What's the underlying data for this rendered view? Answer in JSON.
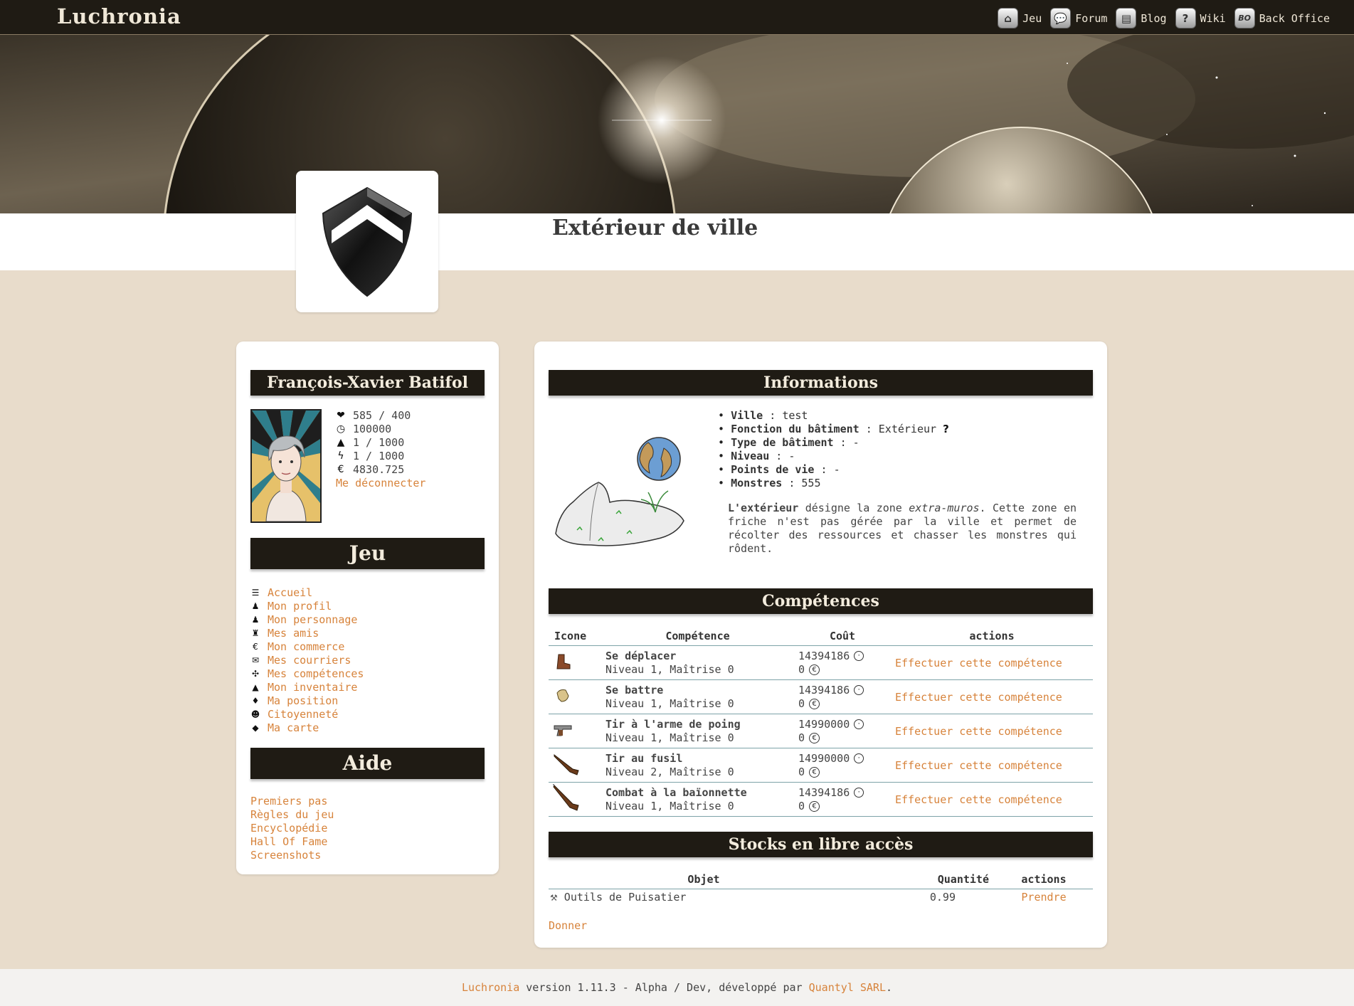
{
  "topbar": {
    "brand": "Luchronia",
    "nav": [
      {
        "label": "Jeu",
        "icon": "home-icon",
        "glyph": "⌂"
      },
      {
        "label": "Forum",
        "icon": "speech-bubble-icon",
        "glyph": "💬"
      },
      {
        "label": "Blog",
        "icon": "book-icon",
        "glyph": "▤"
      },
      {
        "label": "Wiki",
        "icon": "question-icon",
        "glyph": "?"
      },
      {
        "label": "Back Office",
        "icon": "bo-icon",
        "glyph": "BO"
      }
    ]
  },
  "page": {
    "title": "Extérieur de ville"
  },
  "sidebar": {
    "player_name": "François-Xavier Batifol",
    "stats": [
      {
        "icon": "heart-icon",
        "glyph": "❤",
        "value": "585 / 400"
      },
      {
        "icon": "clock-icon",
        "glyph": "◷",
        "value": "100000"
      },
      {
        "icon": "drop-icon",
        "glyph": "▲",
        "value": "1 / 1000"
      },
      {
        "icon": "lightning-icon",
        "glyph": "ϟ",
        "value": "1 / 1000"
      },
      {
        "icon": "euro-icon",
        "glyph": "€",
        "value": "4830.725"
      }
    ],
    "logout": "Me déconnecter",
    "game_title": "Jeu",
    "game_menu": [
      {
        "label": "Accueil",
        "icon": "list-icon",
        "glyph": "☰"
      },
      {
        "label": "Mon profil",
        "icon": "person-icon",
        "glyph": "♟"
      },
      {
        "label": "Mon personnage",
        "icon": "character-icon",
        "glyph": "♟"
      },
      {
        "label": "Mes amis",
        "icon": "friends-icon",
        "glyph": "♜"
      },
      {
        "label": "Mon commerce",
        "icon": "euro-icon",
        "glyph": "€"
      },
      {
        "label": "Mes courriers",
        "icon": "envelope-icon",
        "glyph": "✉"
      },
      {
        "label": "Mes compétences",
        "icon": "skills-icon",
        "glyph": "✣"
      },
      {
        "label": "Mon inventaire",
        "icon": "bag-icon",
        "glyph": "▲"
      },
      {
        "label": "Ma position",
        "icon": "pin-icon",
        "glyph": "♦"
      },
      {
        "label": "Citoyenneté",
        "icon": "citizen-icon",
        "glyph": "☻"
      },
      {
        "label": "Ma carte",
        "icon": "map-icon",
        "glyph": "◆"
      }
    ],
    "help_title": "Aide",
    "help_menu": [
      "Premiers pas",
      "Règles du jeu",
      "Encyclopédie",
      "Hall Of Fame",
      "Screenshots"
    ]
  },
  "informations": {
    "title": "Informations",
    "fields": [
      {
        "label": "Ville",
        "value": "test"
      },
      {
        "label": "Fonction du bâtiment",
        "value": "Extérieur"
      },
      {
        "label": "Type de bâtiment",
        "value": "-"
      },
      {
        "label": "Niveau",
        "value": "-"
      },
      {
        "label": "Points de vie",
        "value": "-"
      },
      {
        "label": "Monstres",
        "value": "555"
      }
    ],
    "help_marker": "?",
    "desc_bold": "L'extérieur",
    "desc_1": " désigne la zone ",
    "desc_italic": "extra-muros",
    "desc_2": ". Cette zone en friche n'est pas gérée par la ville et permet de récolter des ressources et chasser les monstres qui rôdent."
  },
  "competences": {
    "title": "Compétences",
    "headers": [
      "Icone",
      "Compétence",
      "Coût",
      "actions"
    ],
    "rows": [
      {
        "icon": "boot-icon",
        "name": "Se déplacer",
        "detail": "Niveau 1, Maîtrise 0",
        "time": "14394186",
        "money": "0",
        "action": "Effectuer cette compétence"
      },
      {
        "icon": "fist-icon",
        "name": "Se battre",
        "detail": "Niveau 1, Maîtrise 0",
        "time": "14394186",
        "money": "0",
        "action": "Effectuer cette compétence"
      },
      {
        "icon": "pistol-icon",
        "name": "Tir à l'arme de poing",
        "detail": "Niveau 1, Maîtrise 0",
        "time": "14990000",
        "money": "0",
        "action": "Effectuer cette compétence"
      },
      {
        "icon": "rifle-icon",
        "name": "Tir au fusil",
        "detail": "Niveau 2, Maîtrise 0",
        "time": "14990000",
        "money": "0",
        "action": "Effectuer cette compétence"
      },
      {
        "icon": "bayonet-icon",
        "name": "Combat à la baïonnette",
        "detail": "Niveau 1, Maîtrise 0",
        "time": "14394186",
        "money": "0",
        "action": "Effectuer cette compétence"
      }
    ]
  },
  "stocks": {
    "title": "Stocks en libre accès",
    "headers": [
      "Objet",
      "Quantité",
      "actions"
    ],
    "rows": [
      {
        "name": "Outils de Puisatier",
        "quantity": "0.99",
        "action": "Prendre"
      }
    ],
    "give": "Donner"
  },
  "footer": {
    "brand": "Luchronia",
    "text": " version 1.11.3 - Alpha / Dev, développé par ",
    "company": "Quantyl SARL",
    "end": "."
  }
}
